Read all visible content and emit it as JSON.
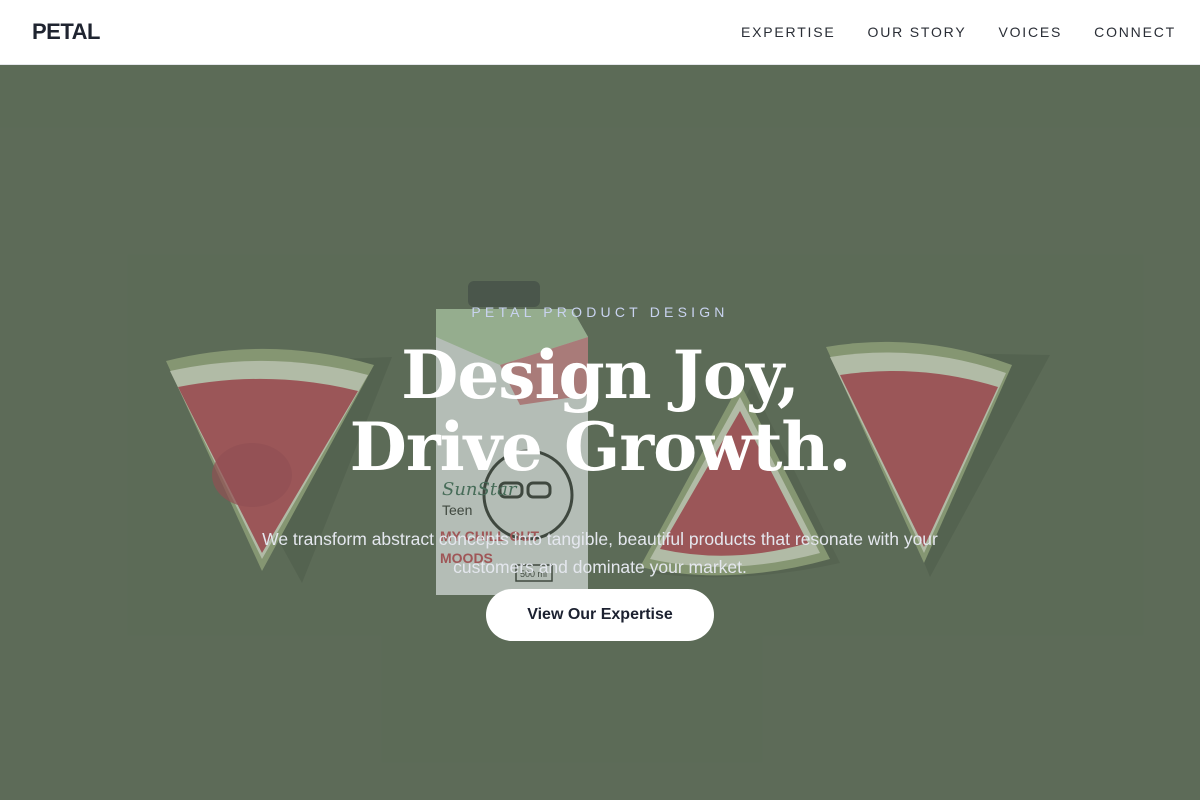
{
  "nav": {
    "brand": "PETAL",
    "links": [
      {
        "label": "EXPERTISE"
      },
      {
        "label": "OUR STORY"
      },
      {
        "label": "VOICES"
      },
      {
        "label": "CONNECT"
      }
    ]
  },
  "hero": {
    "eyebrow": "PETAL PRODUCT DESIGN",
    "headline_line1": "Design Joy,",
    "headline_line2": "Drive Growth.",
    "subtext": "We transform abstract concepts into tangible, beautiful products that resonate with your customers and dominate your market.",
    "cta_label": "View Our Expertise",
    "carton_text": {
      "brand": "SunStar",
      "line1": "Teen",
      "line2": "MY CHILL OUT",
      "line3": "MOODS",
      "volume": "500 ml"
    }
  },
  "colors": {
    "hero_background": "#5d6b58",
    "nav_background": "#ffffff",
    "brand_text": "#1f2430",
    "eyebrow_text": "#c9d3f0",
    "watermelon_flesh": "#c24a5a",
    "watermelon_rind": "#d9e3c4"
  }
}
